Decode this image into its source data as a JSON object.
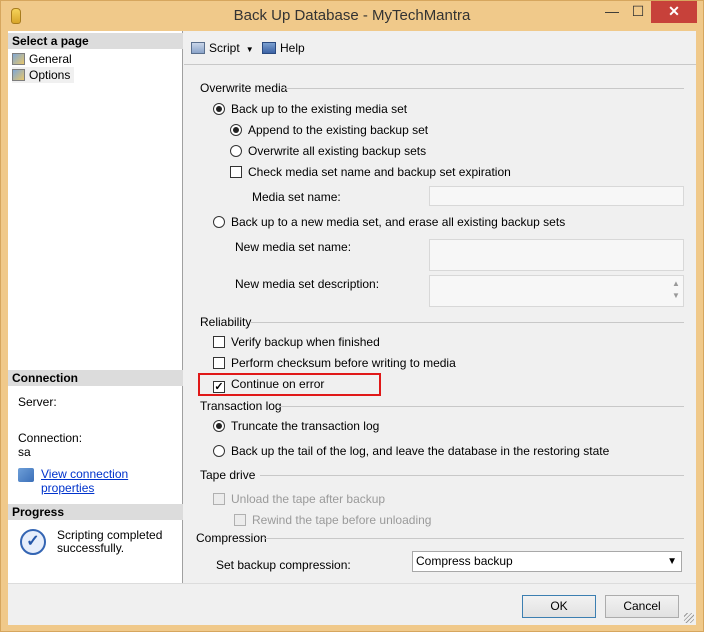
{
  "window": {
    "title": "Back Up Database - MyTechMantra",
    "minimize_glyph": "—",
    "maximize_glyph": "☐",
    "close_glyph": "✕"
  },
  "sidebar": {
    "select_page_header": "Select a page",
    "pages": [
      {
        "label": "General",
        "icon": "page-icon"
      },
      {
        "label": "Options",
        "icon": "page-icon",
        "selected": true
      }
    ],
    "connection_header": "Connection",
    "server_label": "Server:",
    "connection_label": "Connection:",
    "connection_value": "sa",
    "view_connection_link": "View connection properties",
    "progress_header": "Progress",
    "progress_status": "Scripting completed successfully.",
    "progress_icon": "checkmark-circle-icon"
  },
  "toolbar": {
    "script_label": "Script",
    "dropdown_glyph": "▼",
    "help_label": "Help"
  },
  "overwrite_media": {
    "label": "Overwrite media",
    "existing_set": "Back up to the existing media set",
    "append": "Append to the existing backup set",
    "overwrite_all": "Overwrite all existing backup sets",
    "check_expiration": "Check media set name and backup set expiration",
    "media_set_name": "Media set name:",
    "new_media_set": "Back up to a new media set, and erase all existing backup sets",
    "new_media_set_name": "New media set name:",
    "new_media_set_description": "New media set description:"
  },
  "reliability": {
    "label": "Reliability",
    "verify": "Verify backup when finished",
    "checksum": "Perform checksum before writing to media",
    "continue_on_error": "Continue on error",
    "check_glyph": "✓"
  },
  "transaction_log": {
    "label": "Transaction log",
    "truncate": "Truncate the transaction log",
    "tail": "Back up the tail of the log, and leave the database in the restoring state"
  },
  "tape_drive": {
    "label": "Tape drive",
    "unload": "Unload the tape after backup",
    "rewind": "Rewind the tape before unloading"
  },
  "compression": {
    "label": "Compression",
    "set_label": "Set backup compression:",
    "selected": "Compress backup",
    "arrow_glyph": "▼"
  },
  "footer": {
    "ok_label": "OK",
    "cancel_label": "Cancel"
  },
  "colors": {
    "title_bar": "#f0c98a",
    "close_button": "#c7413a",
    "highlight_box": "#e01818",
    "link": "#0033cc"
  }
}
